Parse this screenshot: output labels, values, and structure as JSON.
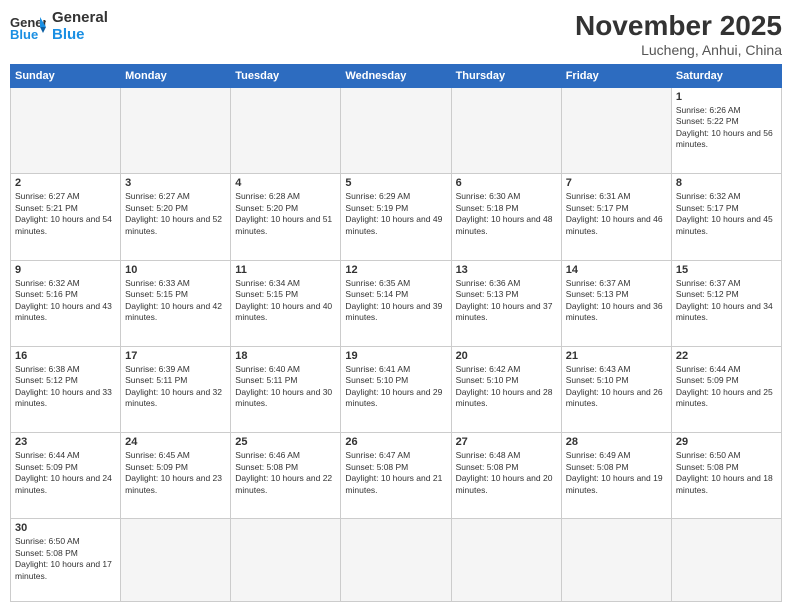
{
  "header": {
    "logo_general": "General",
    "logo_blue": "Blue",
    "month_title": "November 2025",
    "location": "Lucheng, Anhui, China"
  },
  "weekdays": [
    "Sunday",
    "Monday",
    "Tuesday",
    "Wednesday",
    "Thursday",
    "Friday",
    "Saturday"
  ],
  "weeks": [
    [
      {
        "day": "",
        "text": ""
      },
      {
        "day": "",
        "text": ""
      },
      {
        "day": "",
        "text": ""
      },
      {
        "day": "",
        "text": ""
      },
      {
        "day": "",
        "text": ""
      },
      {
        "day": "",
        "text": ""
      },
      {
        "day": "1",
        "text": "Sunrise: 6:26 AM\nSunset: 5:22 PM\nDaylight: 10 hours and 56 minutes."
      }
    ],
    [
      {
        "day": "2",
        "text": "Sunrise: 6:27 AM\nSunset: 5:21 PM\nDaylight: 10 hours and 54 minutes."
      },
      {
        "day": "3",
        "text": "Sunrise: 6:27 AM\nSunset: 5:20 PM\nDaylight: 10 hours and 52 minutes."
      },
      {
        "day": "4",
        "text": "Sunrise: 6:28 AM\nSunset: 5:20 PM\nDaylight: 10 hours and 51 minutes."
      },
      {
        "day": "5",
        "text": "Sunrise: 6:29 AM\nSunset: 5:19 PM\nDaylight: 10 hours and 49 minutes."
      },
      {
        "day": "6",
        "text": "Sunrise: 6:30 AM\nSunset: 5:18 PM\nDaylight: 10 hours and 48 minutes."
      },
      {
        "day": "7",
        "text": "Sunrise: 6:31 AM\nSunset: 5:17 PM\nDaylight: 10 hours and 46 minutes."
      },
      {
        "day": "8",
        "text": "Sunrise: 6:32 AM\nSunset: 5:17 PM\nDaylight: 10 hours and 45 minutes."
      }
    ],
    [
      {
        "day": "9",
        "text": "Sunrise: 6:32 AM\nSunset: 5:16 PM\nDaylight: 10 hours and 43 minutes."
      },
      {
        "day": "10",
        "text": "Sunrise: 6:33 AM\nSunset: 5:15 PM\nDaylight: 10 hours and 42 minutes."
      },
      {
        "day": "11",
        "text": "Sunrise: 6:34 AM\nSunset: 5:15 PM\nDaylight: 10 hours and 40 minutes."
      },
      {
        "day": "12",
        "text": "Sunrise: 6:35 AM\nSunset: 5:14 PM\nDaylight: 10 hours and 39 minutes."
      },
      {
        "day": "13",
        "text": "Sunrise: 6:36 AM\nSunset: 5:13 PM\nDaylight: 10 hours and 37 minutes."
      },
      {
        "day": "14",
        "text": "Sunrise: 6:37 AM\nSunset: 5:13 PM\nDaylight: 10 hours and 36 minutes."
      },
      {
        "day": "15",
        "text": "Sunrise: 6:37 AM\nSunset: 5:12 PM\nDaylight: 10 hours and 34 minutes."
      }
    ],
    [
      {
        "day": "16",
        "text": "Sunrise: 6:38 AM\nSunset: 5:12 PM\nDaylight: 10 hours and 33 minutes."
      },
      {
        "day": "17",
        "text": "Sunrise: 6:39 AM\nSunset: 5:11 PM\nDaylight: 10 hours and 32 minutes."
      },
      {
        "day": "18",
        "text": "Sunrise: 6:40 AM\nSunset: 5:11 PM\nDaylight: 10 hours and 30 minutes."
      },
      {
        "day": "19",
        "text": "Sunrise: 6:41 AM\nSunset: 5:10 PM\nDaylight: 10 hours and 29 minutes."
      },
      {
        "day": "20",
        "text": "Sunrise: 6:42 AM\nSunset: 5:10 PM\nDaylight: 10 hours and 28 minutes."
      },
      {
        "day": "21",
        "text": "Sunrise: 6:43 AM\nSunset: 5:10 PM\nDaylight: 10 hours and 26 minutes."
      },
      {
        "day": "22",
        "text": "Sunrise: 6:44 AM\nSunset: 5:09 PM\nDaylight: 10 hours and 25 minutes."
      }
    ],
    [
      {
        "day": "23",
        "text": "Sunrise: 6:44 AM\nSunset: 5:09 PM\nDaylight: 10 hours and 24 minutes."
      },
      {
        "day": "24",
        "text": "Sunrise: 6:45 AM\nSunset: 5:09 PM\nDaylight: 10 hours and 23 minutes."
      },
      {
        "day": "25",
        "text": "Sunrise: 6:46 AM\nSunset: 5:08 PM\nDaylight: 10 hours and 22 minutes."
      },
      {
        "day": "26",
        "text": "Sunrise: 6:47 AM\nSunset: 5:08 PM\nDaylight: 10 hours and 21 minutes."
      },
      {
        "day": "27",
        "text": "Sunrise: 6:48 AM\nSunset: 5:08 PM\nDaylight: 10 hours and 20 minutes."
      },
      {
        "day": "28",
        "text": "Sunrise: 6:49 AM\nSunset: 5:08 PM\nDaylight: 10 hours and 19 minutes."
      },
      {
        "day": "29",
        "text": "Sunrise: 6:50 AM\nSunset: 5:08 PM\nDaylight: 10 hours and 18 minutes."
      }
    ],
    [
      {
        "day": "30",
        "text": "Sunrise: 6:50 AM\nSunset: 5:08 PM\nDaylight: 10 hours and 17 minutes."
      },
      {
        "day": "",
        "text": ""
      },
      {
        "day": "",
        "text": ""
      },
      {
        "day": "",
        "text": ""
      },
      {
        "day": "",
        "text": ""
      },
      {
        "day": "",
        "text": ""
      },
      {
        "day": "",
        "text": ""
      }
    ]
  ]
}
